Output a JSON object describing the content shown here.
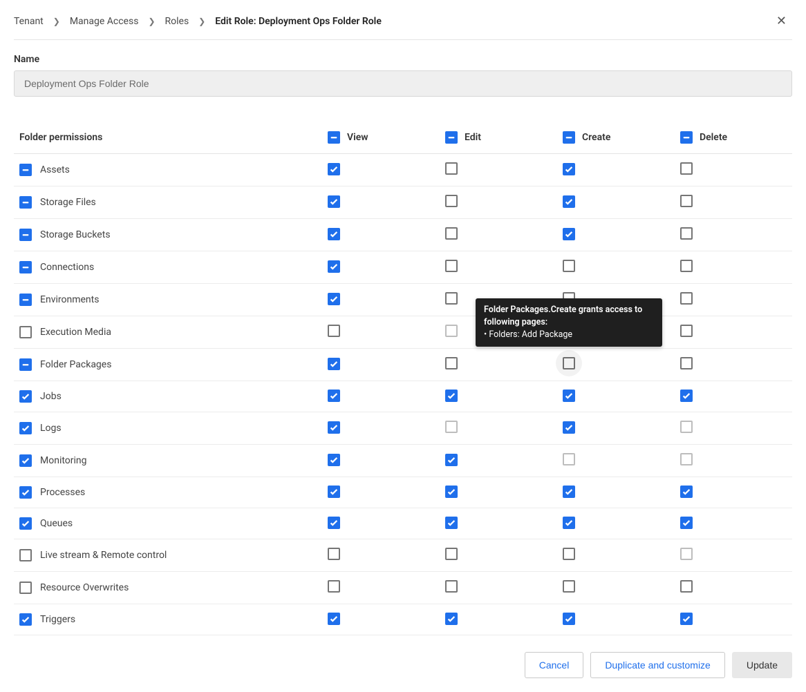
{
  "breadcrumb": {
    "items": [
      "Tenant",
      "Manage Access",
      "Roles"
    ],
    "current": "Edit Role: Deployment Ops Folder Role"
  },
  "name": {
    "label": "Name",
    "value": "Deployment Ops Folder Role"
  },
  "table": {
    "header_label": "Folder permissions",
    "columns": [
      "View",
      "Edit",
      "Create",
      "Delete"
    ],
    "column_header_state": [
      "indeterminate",
      "indeterminate",
      "indeterminate",
      "indeterminate"
    ],
    "rows": [
      {
        "label": "Assets",
        "row_state": "indeterminate",
        "cells": [
          "checked",
          "empty",
          "checked",
          "empty"
        ]
      },
      {
        "label": "Storage Files",
        "row_state": "indeterminate",
        "cells": [
          "checked",
          "empty",
          "checked",
          "empty"
        ]
      },
      {
        "label": "Storage Buckets",
        "row_state": "indeterminate",
        "cells": [
          "checked",
          "empty",
          "checked",
          "empty"
        ]
      },
      {
        "label": "Connections",
        "row_state": "indeterminate",
        "cells": [
          "checked",
          "empty",
          "empty",
          "empty"
        ]
      },
      {
        "label": "Environments",
        "row_state": "indeterminate",
        "cells": [
          "checked",
          "empty",
          "empty",
          "empty"
        ]
      },
      {
        "label": "Execution Media",
        "row_state": "empty",
        "cells": [
          "empty",
          "empty-dim",
          "empty-dim",
          "empty"
        ]
      },
      {
        "label": "Folder Packages",
        "row_state": "indeterminate",
        "cells": [
          "checked",
          "empty",
          "empty-hover",
          "empty"
        ]
      },
      {
        "label": "Jobs",
        "row_state": "checked",
        "cells": [
          "checked",
          "checked",
          "checked",
          "checked"
        ]
      },
      {
        "label": "Logs",
        "row_state": "checked",
        "cells": [
          "checked",
          "empty-dim",
          "checked",
          "empty-dim"
        ]
      },
      {
        "label": "Monitoring",
        "row_state": "checked",
        "cells": [
          "checked",
          "checked",
          "empty-dim",
          "empty-dim"
        ]
      },
      {
        "label": "Processes",
        "row_state": "checked",
        "cells": [
          "checked",
          "checked",
          "checked",
          "checked"
        ]
      },
      {
        "label": "Queues",
        "row_state": "checked",
        "cells": [
          "checked",
          "checked",
          "checked",
          "checked"
        ]
      },
      {
        "label": "Live stream & Remote control",
        "row_state": "empty",
        "cells": [
          "empty",
          "empty",
          "empty",
          "empty-dim"
        ]
      },
      {
        "label": "Resource Overwrites",
        "row_state": "empty",
        "cells": [
          "empty",
          "empty",
          "empty",
          "empty"
        ]
      },
      {
        "label": "Triggers",
        "row_state": "checked",
        "cells": [
          "checked",
          "checked",
          "checked",
          "checked"
        ]
      }
    ]
  },
  "tooltip": {
    "line1": "Folder Packages.Create grants access to following pages:",
    "line2": "• Folders: Add Package"
  },
  "footer": {
    "cancel": "Cancel",
    "duplicate": "Duplicate and customize",
    "update": "Update"
  }
}
